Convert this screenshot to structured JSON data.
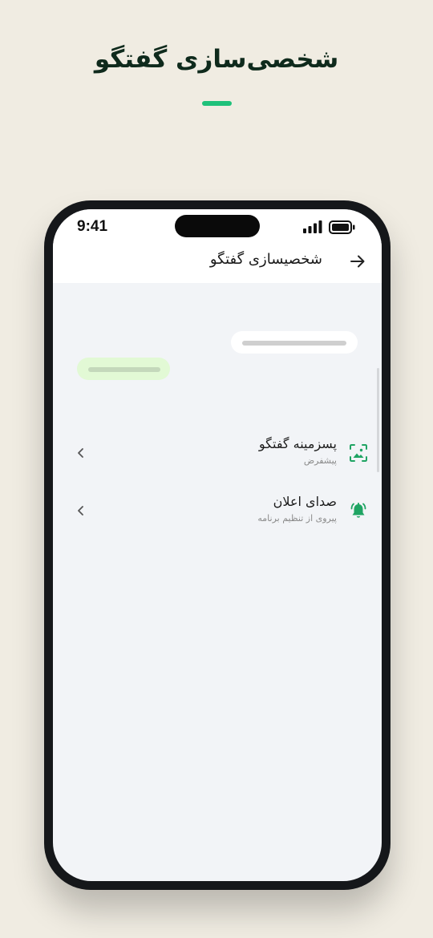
{
  "promo": {
    "title": "شخصی‌سازی گفتگو",
    "accent_color": "#1fc17a"
  },
  "status_bar": {
    "time": "9:41",
    "icons": [
      "signal-icon",
      "battery-icon"
    ]
  },
  "nav": {
    "title": "شخصیسازی گفتگو",
    "back_icon": "arrow-right-icon"
  },
  "preview": {
    "incoming_bubble_color": "#ffffff",
    "outgoing_bubble_color": "#e2f9d5"
  },
  "settings": [
    {
      "title": "پسزمینه گفتگو",
      "subtitle": "پیشفرض",
      "icon": "wallpaper-icon",
      "trailing_icon": "chevron-left-icon"
    },
    {
      "title": "صدای اعلان",
      "subtitle": "پیروی از تنظیم برنامه",
      "icon": "bell-ringing-icon",
      "trailing_icon": "chevron-left-icon"
    }
  ]
}
